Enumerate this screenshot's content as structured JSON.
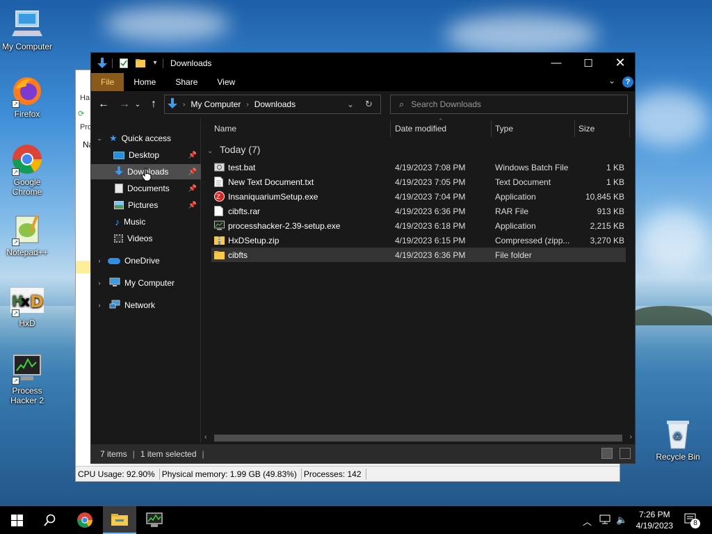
{
  "desktop": {
    "icons": [
      {
        "label": "My Computer"
      },
      {
        "label": "Firefox"
      },
      {
        "label": "Google Chrome"
      },
      {
        "label": "Notepad++"
      },
      {
        "label": "HxD"
      },
      {
        "label": "Process Hacker 2"
      },
      {
        "label": "Recycle Bin"
      }
    ]
  },
  "background_window": {
    "left_strip": [
      "Ha",
      "Pro",
      "Na"
    ],
    "status": {
      "cpu": "CPU Usage: 92.90%",
      "memory": "Physical memory: 1.99 GB (49.83%)",
      "processes": "Processes: 142"
    }
  },
  "explorer": {
    "title": "Downloads",
    "ribbon_tabs": [
      "File",
      "Home",
      "Share",
      "View"
    ],
    "breadcrumb": [
      "My Computer",
      "Downloads"
    ],
    "search_placeholder": "Search Downloads",
    "nav": {
      "quick_access": "Quick access",
      "desktop": "Desktop",
      "downloads": "Downloads",
      "documents": "Documents",
      "pictures": "Pictures",
      "music": "Music",
      "videos": "Videos",
      "onedrive": "OneDrive",
      "my_computer": "My Computer",
      "network": "Network"
    },
    "columns": [
      "Name",
      "Date modified",
      "Type",
      "Size"
    ],
    "group_label": "Today (7)",
    "files": [
      {
        "name": "test.bat",
        "date": "4/19/2023 7:08 PM",
        "type": "Windows Batch File",
        "size": "1 KB",
        "icon": "batch-file-icon"
      },
      {
        "name": "New Text Document.txt",
        "date": "4/19/2023 7:05 PM",
        "type": "Text Document",
        "size": "1 KB",
        "icon": "text-file-icon"
      },
      {
        "name": "InsaniquariumSetup.exe",
        "date": "4/19/2023 7:04 PM",
        "type": "Application",
        "size": "10,845 KB",
        "icon": "installer-icon"
      },
      {
        "name": "cibfts.rar",
        "date": "4/19/2023 6:36 PM",
        "type": "RAR File",
        "size": "913 KB",
        "icon": "file-icon"
      },
      {
        "name": "processhacker-2.39-setup.exe",
        "date": "4/19/2023 6:18 PM",
        "type": "Application",
        "size": "2,215 KB",
        "icon": "process-hacker-icon"
      },
      {
        "name": "HxDSetup.zip",
        "date": "4/19/2023 6:15 PM",
        "type": "Compressed (zipp...",
        "size": "3,270 KB",
        "icon": "zip-folder-icon"
      },
      {
        "name": "cibfts",
        "date": "4/19/2023 6:36 PM",
        "type": "File folder",
        "size": "",
        "icon": "folder-icon"
      }
    ],
    "status": {
      "items": "7 items",
      "selected": "1 item selected"
    }
  },
  "taskbar": {
    "time": "7:26 PM",
    "date": "4/19/2023",
    "notification_count": "8"
  }
}
